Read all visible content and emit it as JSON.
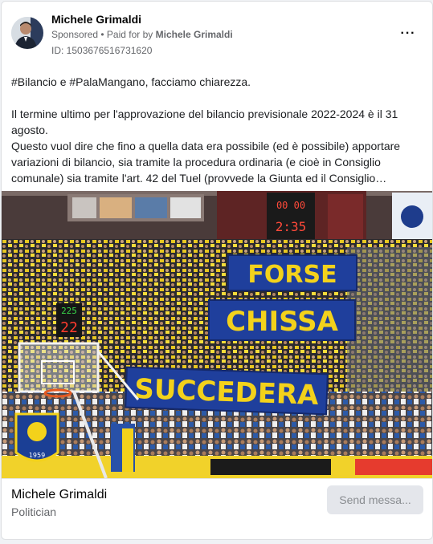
{
  "post": {
    "author_name": "Michele Grimaldi",
    "sponsored_label": "Sponsored",
    "paid_for_prefix": "• Paid for by",
    "paid_for_name": "Michele Grimaldi",
    "ad_id": "ID: 1503676516731620",
    "more_icon": "···",
    "text_lines": [
      "#Bilancio e #PalaMangano, facciamo chiarezza.",
      "Il termine ultimo per l'approvazione del bilancio previsionale 2022-2024 è il 31 agosto.",
      "Questo vuol dire che fino a quella data era possibile (ed è possibile) apportare variazioni di bilancio, sia tramite la procedura ordinaria (e cioè in Consiglio comunale) sia tramite l'art. 42 del Tuel (provvede la Giunta ed il Consiglio…"
    ],
    "image": {
      "banners": [
        "FORSE",
        "CHISSA",
        "SUCCEDERA"
      ],
      "scoreboard_top": "00 00",
      "scoreboard_clock": "2:35",
      "shot_clock_top": "225",
      "shot_clock_bottom": "22",
      "crest_year": "1959"
    }
  },
  "footer": {
    "page_name": "Michele Grimaldi",
    "page_category": "Politician",
    "cta_label": "Send messa..."
  },
  "colors": {
    "banner_blue": "#1f3f9c",
    "banner_yellow": "#f3d21b",
    "cta_bg": "#e4e6eb",
    "secondary_text": "#65676b"
  }
}
